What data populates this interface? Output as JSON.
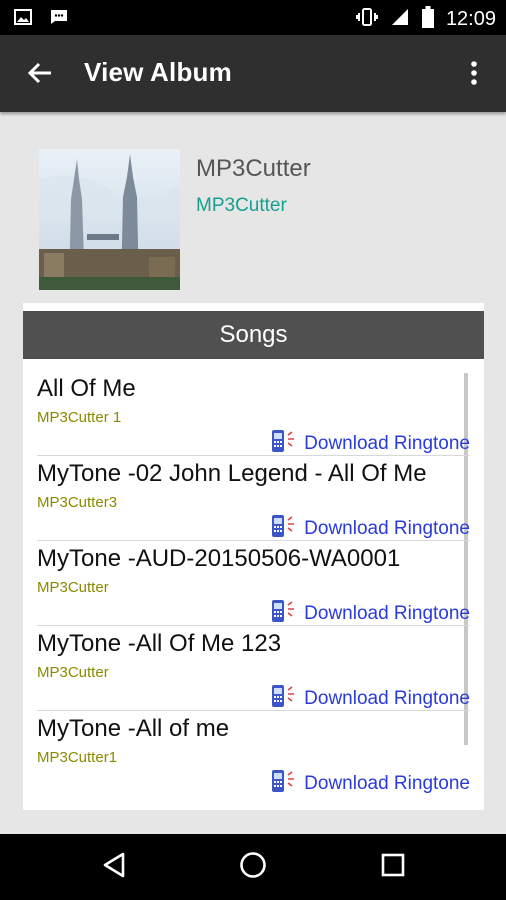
{
  "status_bar": {
    "time": "12:09",
    "icons": [
      "image-icon",
      "message-icon",
      "vibrate-icon",
      "signal-icon",
      "battery-icon"
    ]
  },
  "app_bar": {
    "title": "View Album",
    "back_icon": "arrow-back-icon",
    "menu_icon": "more-vert-icon"
  },
  "album": {
    "title": "MP3Cutter",
    "artist": "MP3Cutter"
  },
  "songs": {
    "header": "Songs",
    "items": [
      {
        "title": "All Of Me",
        "artist": "MP3Cutter 1",
        "action": "Download Ringtone"
      },
      {
        "title": "MyTone -02 John Legend  - All Of Me",
        "artist": "MP3Cutter3",
        "action": "Download Ringtone"
      },
      {
        "title": "MyTone -AUD-20150506-WA0001",
        "artist": "MP3Cutter",
        "action": "Download Ringtone"
      },
      {
        "title": "MyTone -All Of Me 123",
        "artist": "MP3Cutter",
        "action": "Download Ringtone"
      },
      {
        "title": "MyTone -All of me",
        "artist": "MP3Cutter1",
        "action": "Download Ringtone"
      }
    ]
  },
  "nav_bar": {
    "icons": [
      "back-triangle-icon",
      "home-circle-icon",
      "recents-square-icon"
    ]
  },
  "colors": {
    "app_bar": "#2f2f2f",
    "accent_teal": "#15a08f",
    "artist_olive": "#8a8a00",
    "link_blue": "#2a3bd6"
  }
}
